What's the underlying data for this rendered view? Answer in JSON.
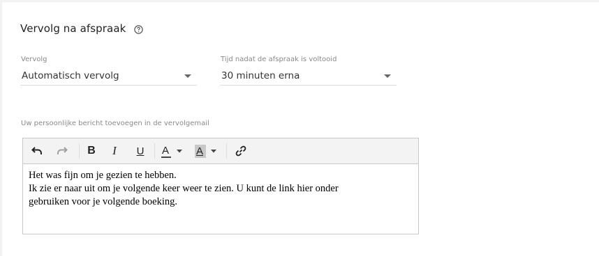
{
  "section": {
    "title": "Vervolg na afspraak",
    "help_icon": "help-circle-icon"
  },
  "followup": {
    "label": "Vervolg",
    "value": "Automatisch vervolg"
  },
  "timing": {
    "label": "Tijd nadat de afspraak is voltooid",
    "value": "30 minuten erna"
  },
  "message": {
    "label": "Uw persoonlijke bericht toevoegen in de vervolgemail",
    "lines": [
      "Het was fijn om je gezien te hebben.",
      "Ik zie er naar uit om je volgende keer weer te zien. U kunt de link hier onder",
      "gebruiken voor je volgende boeking."
    ]
  },
  "toolbar": {
    "icons": [
      "undo-icon",
      "redo-icon",
      "bold-icon",
      "italic-icon",
      "underline-icon",
      "text-color-icon",
      "background-color-icon",
      "link-icon"
    ],
    "bold": "B",
    "italic": "I",
    "underline": "U",
    "text_color": "A",
    "background_color": "A"
  },
  "colors": {
    "text_color_bar": "#444444",
    "background_color_chip": "#c8c8c8"
  }
}
